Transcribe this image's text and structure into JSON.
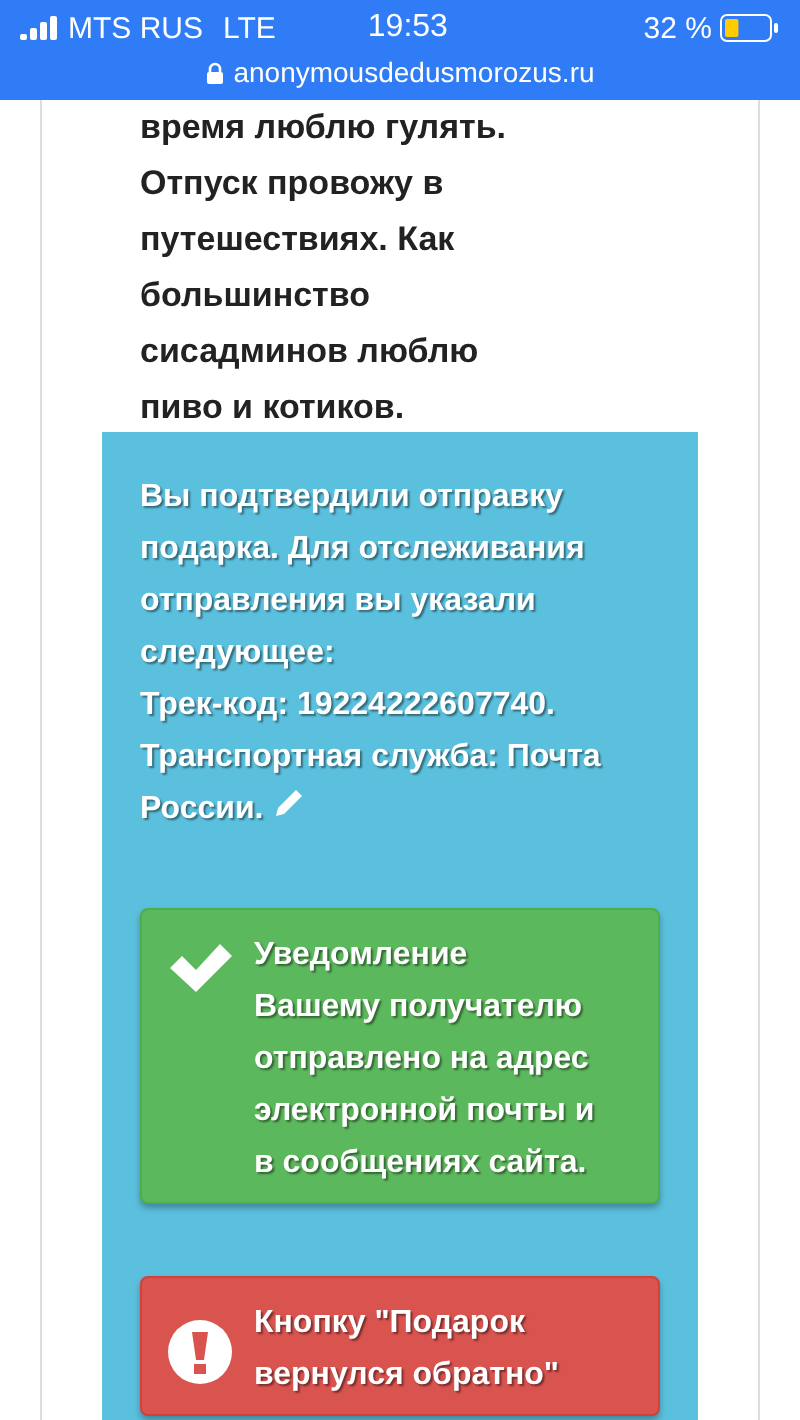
{
  "status_bar": {
    "carrier": "MTS RUS",
    "network": "LTE",
    "time": "19:53",
    "battery": "32 %",
    "url": "anonymousdedusmorozus.ru"
  },
  "profile_text": [
    "время люблю гулять.",
    "Отпуск провожу в",
    "путешествиях. Как",
    "большинство",
    "сисадминов люблю",
    "пиво и котиков."
  ],
  "confirmation": {
    "lines": [
      "Вы подтвердили отправку",
      "подарка. Для отслеживания",
      "отправления вы указали",
      "следующее:",
      "Трек-код: 19224222607740.",
      "Транспортная служба: Почта",
      "России."
    ]
  },
  "alerts": [
    {
      "kind": "success",
      "lines": [
        "Уведомление",
        "Вашему получателю",
        "отправлено на адрес",
        "электронной почты и",
        "в сообщениях сайта."
      ]
    },
    {
      "kind": "danger",
      "lines": [
        "Кнопку \"Подарок",
        "вернулся обратно\""
      ]
    }
  ]
}
